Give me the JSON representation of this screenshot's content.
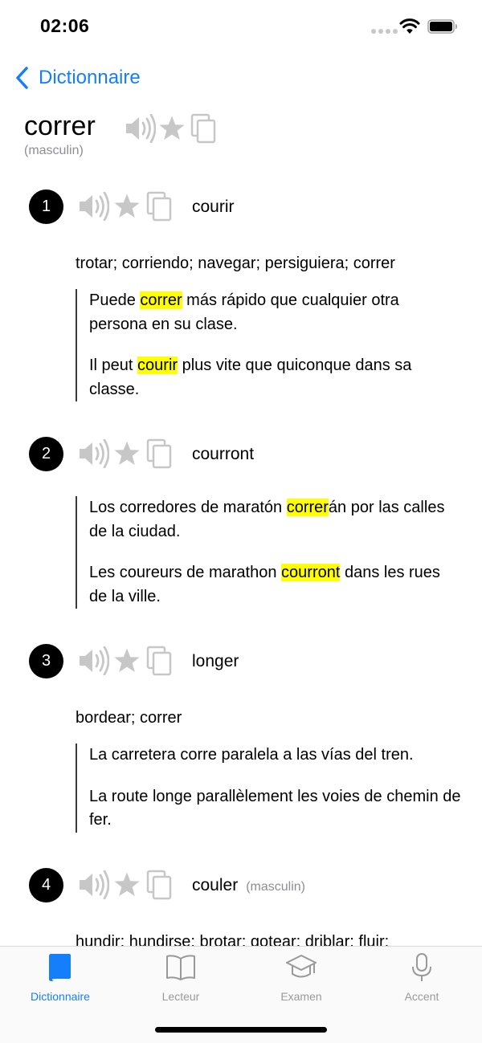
{
  "status_bar": {
    "time": "02:06"
  },
  "nav": {
    "back_label": "Dictionnaire"
  },
  "entry": {
    "headword": "correr",
    "gender": "(masculin)"
  },
  "senses": [
    {
      "number": "1",
      "word": "courir",
      "gender": "",
      "translations": "trotar; corriendo; navegar; persiguiera; correr",
      "examples": [
        {
          "pre": "Puede ",
          "hl": "correr",
          "post": " más rápido que cualquier otra persona en su clase."
        },
        {
          "pre": "Il peut ",
          "hl": "courir",
          "post": " plus vite que quiconque dans sa classe."
        }
      ]
    },
    {
      "number": "2",
      "word": "courront",
      "gender": "",
      "translations": "",
      "examples": [
        {
          "pre": "Los corredores de maratón ",
          "hl": "correr",
          "post": "án por las calles de la ciudad."
        },
        {
          "pre": "Les coureurs de marathon ",
          "hl": "courront",
          "post": " dans les rues de la ville."
        }
      ]
    },
    {
      "number": "3",
      "word": "longer",
      "gender": "",
      "translations": "bordear; correr",
      "examples": [
        {
          "pre": "La carretera corre paralela a las vías del tren.",
          "hl": "",
          "post": ""
        },
        {
          "pre": "La route longe parallèlement les voies de chemin de fer.",
          "hl": "",
          "post": ""
        }
      ]
    },
    {
      "number": "4",
      "word": "couler",
      "gender": "(masculin)",
      "translations": "hundir; hundirse; brotar; gotear; driblar; fluir;",
      "examples": []
    }
  ],
  "tabs": [
    {
      "label": "Dictionnaire",
      "icon": "book-icon",
      "active": true
    },
    {
      "label": "Lecteur",
      "icon": "open-book-icon",
      "active": false
    },
    {
      "label": "Examen",
      "icon": "graduation-cap-icon",
      "active": false
    },
    {
      "label": "Accent",
      "icon": "microphone-icon",
      "active": false
    }
  ],
  "colors": {
    "accent": "#147efb",
    "highlight": "#ffff00",
    "icon_gray": "#c7c7c7",
    "tab_inactive": "#999999"
  }
}
